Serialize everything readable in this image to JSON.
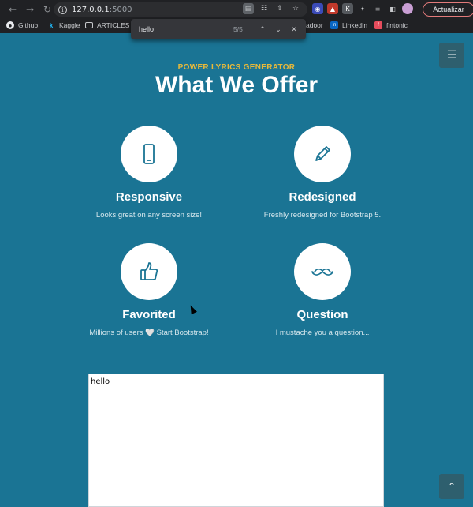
{
  "browser": {
    "url_host": "127.0.0.1",
    "url_port": ":5000",
    "update_button": "Actualizar",
    "bookmarks": [
      {
        "label": "Github",
        "icon": "github-icon"
      },
      {
        "label": "Kaggle",
        "icon": "kaggle-icon"
      },
      {
        "label": "ARTICLES",
        "icon": "folder-icon"
      },
      {
        "label": "adoor",
        "icon": "glassdoor-icon"
      },
      {
        "label": "LinkedIn",
        "icon": "linkedin-icon"
      },
      {
        "label": "fintonic",
        "icon": "fintonic-icon"
      }
    ],
    "find": {
      "query": "hello",
      "count": "5/5"
    }
  },
  "page": {
    "eyebrow": "POWER LYRICS GENERATOR",
    "title": "What We Offer",
    "features": [
      {
        "title": "Responsive",
        "desc": "Looks great on any screen size!",
        "icon": "mobile-phone-icon"
      },
      {
        "title": "Redesigned",
        "desc": "Freshly redesigned for Bootstrap 5.",
        "icon": "pencil-icon"
      },
      {
        "title": "Favorited",
        "desc": "Millions of users 🤍 Start Bootstrap!",
        "icon": "thumbs-up-icon"
      },
      {
        "title": "Question",
        "desc": "I mustache you a question...",
        "icon": "mustache-icon"
      }
    ],
    "output_text": "hello"
  },
  "colors": {
    "background": "#1a7494",
    "accent": "#e8b93a",
    "icon": "#1a7494"
  }
}
